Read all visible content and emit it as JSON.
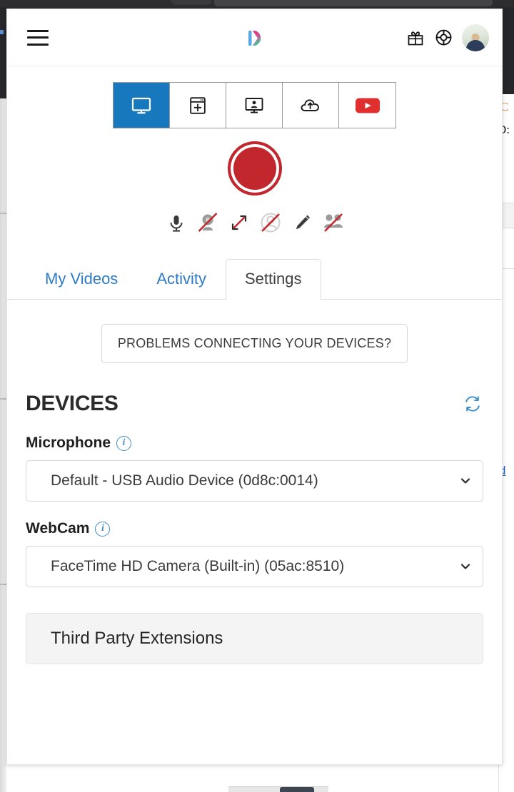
{
  "app": {
    "brand_logo_name": "deskcam-logo",
    "menu_label": "Menu"
  },
  "header": {
    "icons": [
      {
        "name": "gift-icon",
        "label": "Gift"
      },
      {
        "name": "life-ring-help-icon",
        "label": "Help"
      }
    ],
    "avatar_label": "User account"
  },
  "mode_bar": {
    "buttons": [
      {
        "name": "mode-screen",
        "label": "Screen",
        "active": true
      },
      {
        "name": "mode-window",
        "label": "Window",
        "active": false
      },
      {
        "name": "mode-screen-and-webcam",
        "label": "Screen + Webcam",
        "active": false
      },
      {
        "name": "mode-upload",
        "label": "Upload",
        "active": false
      },
      {
        "name": "mode-youtube",
        "label": "YouTube",
        "active": false
      }
    ]
  },
  "record": {
    "label": "Record",
    "color": "#c1272d"
  },
  "controls": [
    {
      "name": "microphone-icon",
      "label": "Microphone",
      "disabled": false
    },
    {
      "name": "webcam-icon",
      "label": "Webcam",
      "disabled": true
    },
    {
      "name": "resize-icon",
      "label": "Resize",
      "disabled": false
    },
    {
      "name": "face-overlay-icon",
      "label": "Face overlay",
      "disabled": true
    },
    {
      "name": "pencil-icon",
      "label": "Draw",
      "disabled": false
    },
    {
      "name": "share-people-icon",
      "label": "Share",
      "disabled": true
    }
  ],
  "tabs": [
    {
      "label": "My Videos",
      "active": false
    },
    {
      "label": "Activity",
      "active": false
    },
    {
      "label": "Settings",
      "active": true
    }
  ],
  "problems_button": {
    "label": "PROBLEMS CONNECTING YOUR DEVICES?"
  },
  "devices": {
    "title": "DEVICES",
    "refresh_label": "Refresh devices",
    "microphone": {
      "label": "Microphone",
      "value": "Default - USB Audio Device (0d8c:0014)",
      "info_label": "i"
    },
    "webcam": {
      "label": "WebCam",
      "value": "FaceTime HD Camera (Built-in) (05ac:8510)",
      "info_label": "i"
    }
  },
  "extensions": {
    "label": "Third Party Extensions"
  },
  "background": {
    "fragments": [
      "C",
      "D:",
      "d"
    ]
  },
  "colors": {
    "accent_blue": "#1878bd",
    "link_blue": "#2f7ac4",
    "record_red": "#c1272d",
    "youtube_red": "#e02f2f",
    "info_blue": "#3f8ecb"
  }
}
